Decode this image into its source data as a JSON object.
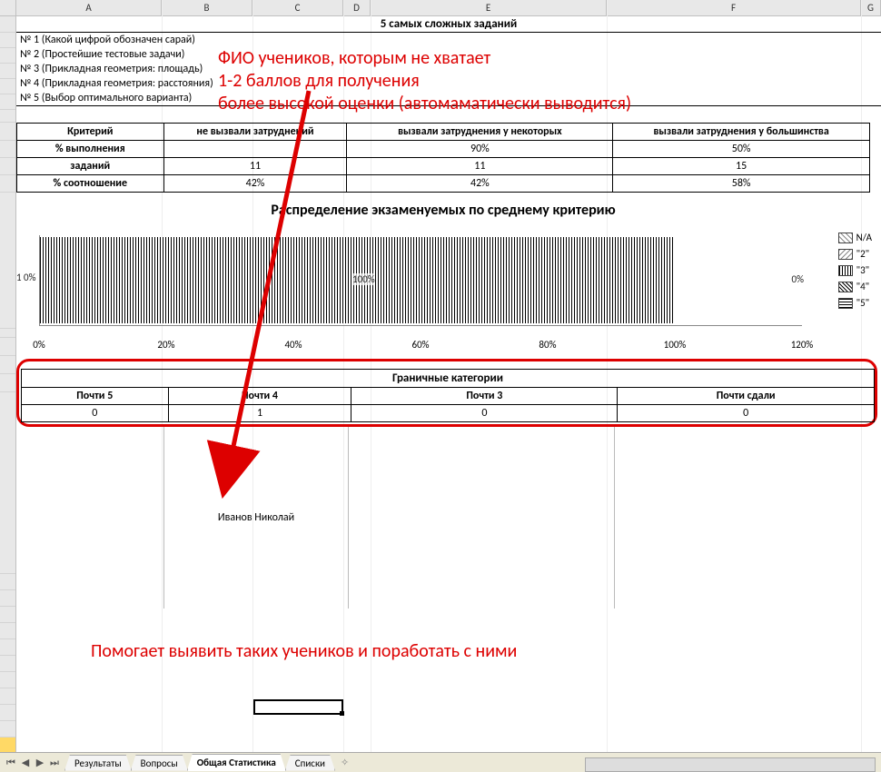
{
  "columns": [
    "A",
    "B",
    "C",
    "D",
    "E",
    "F",
    "G"
  ],
  "section_title": "5  самых сложных заданий",
  "tasks": [
    "№ 1 (Какой цифрой обозначен сарай)",
    "№ 2 (Простейшие тестовые задачи)",
    "№ 3 (Прикладная геометрия: площадь)",
    "№ 4 (Прикладная геометрия: расстояния)",
    "№ 5 (Выбор оптимального варианта)"
  ],
  "criteria": {
    "headers": [
      "Критерий",
      "не вызвали затруднений",
      "вызвали затруднения у некоторых",
      "вызвали затруднения у большинства"
    ],
    "rows": [
      {
        "label": "% выполнения",
        "vals": [
          "",
          "90%",
          "50%"
        ]
      },
      {
        "label": "заданий",
        "vals": [
          "11",
          "11",
          "15"
        ]
      },
      {
        "label": "% соотношение",
        "vals": [
          "42%",
          "42%",
          "58%"
        ]
      }
    ]
  },
  "chart": {
    "title": "Распределение экзаменуемых по среднему критерию",
    "y_label_left": "1 0%",
    "center_label": "100%",
    "right_label": "0%",
    "legend": [
      "N/A",
      "\"2\"",
      "\"3\"",
      "\"4\"",
      "\"5\""
    ],
    "x_ticks": [
      "0%",
      "20%",
      "40%",
      "60%",
      "80%",
      "100%",
      "120%"
    ]
  },
  "chart_data": {
    "type": "bar",
    "orientation": "horizontal-stacked",
    "categories": [
      "1"
    ],
    "series": [
      {
        "name": "N/A",
        "values": [
          0
        ]
      },
      {
        "name": "2",
        "values": [
          0
        ]
      },
      {
        "name": "3",
        "values": [
          100
        ]
      },
      {
        "name": "4",
        "values": [
          0
        ]
      },
      {
        "name": "5",
        "values": [
          0
        ]
      }
    ],
    "xlabel": "",
    "ylabel": "",
    "xlim": [
      0,
      120
    ],
    "title": "Распределение экзаменуемых по среднему критерию"
  },
  "boundary": {
    "title": "Граничные категории",
    "headers": [
      "Почти 5",
      "Почти 4",
      "Почти 3",
      "Почти сдали"
    ],
    "values": [
      "0",
      "1",
      "0",
      "0"
    ],
    "name_rows": [
      "",
      "Иванов Николай",
      "",
      ""
    ]
  },
  "annotations": {
    "top": "ФИО учеников, которым не хватает\n1-2 баллов для получения\nболее высокой оценки (автомаматически выводится)",
    "bottom": "Помогает выявить таких учеников и поработать с ними"
  },
  "tabs": {
    "items": [
      "Результаты",
      "Вопросы",
      "Общая Статистика",
      "Списки"
    ],
    "active": 2,
    "nav": [
      "⏮",
      "◀",
      "▶",
      "⏭"
    ]
  },
  "row_count": 29,
  "highlighted_row_index": 27
}
